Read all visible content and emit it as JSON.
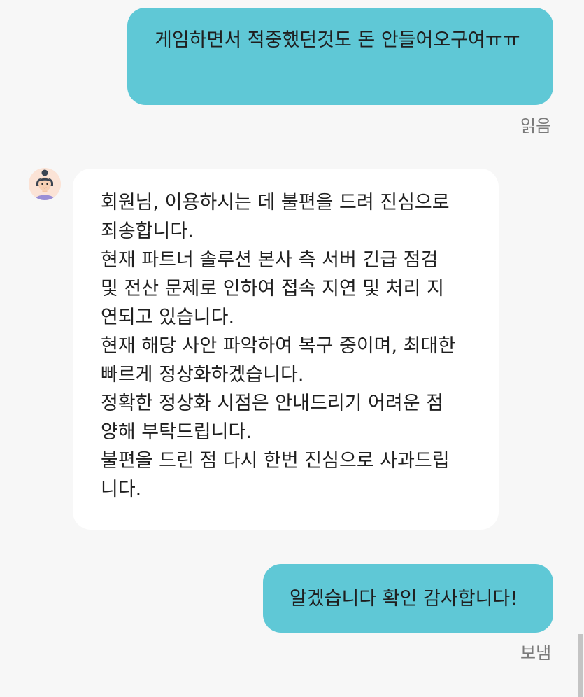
{
  "messages": [
    {
      "text": "게임하면서 적중했던것도 돈 안들어오구여ㅠㅠ",
      "status": "읽음"
    },
    {
      "text": "회원님, 이용하시는 데 불편을 드려 진심으로\n죄송합니다.\n현재 파트너 솔루션 본사 측 서버 긴급 점검\n및 전산 문제로 인하여 접속 지연 및 처리 지\n연되고 있습니다.\n현재 해당 사안 파악하여 복구 중이며, 최대한\n빠르게 정상화하겠습니다.\n정확한 정상화 시점은 안내드리기 어려운 점\n양해 부탁드립니다.\n불편을 드린 점 다시 한번 진심으로 사과드립\n니다."
    },
    {
      "text": "알겠습니다 확인 감사합니다!",
      "status": "보냄"
    }
  ]
}
